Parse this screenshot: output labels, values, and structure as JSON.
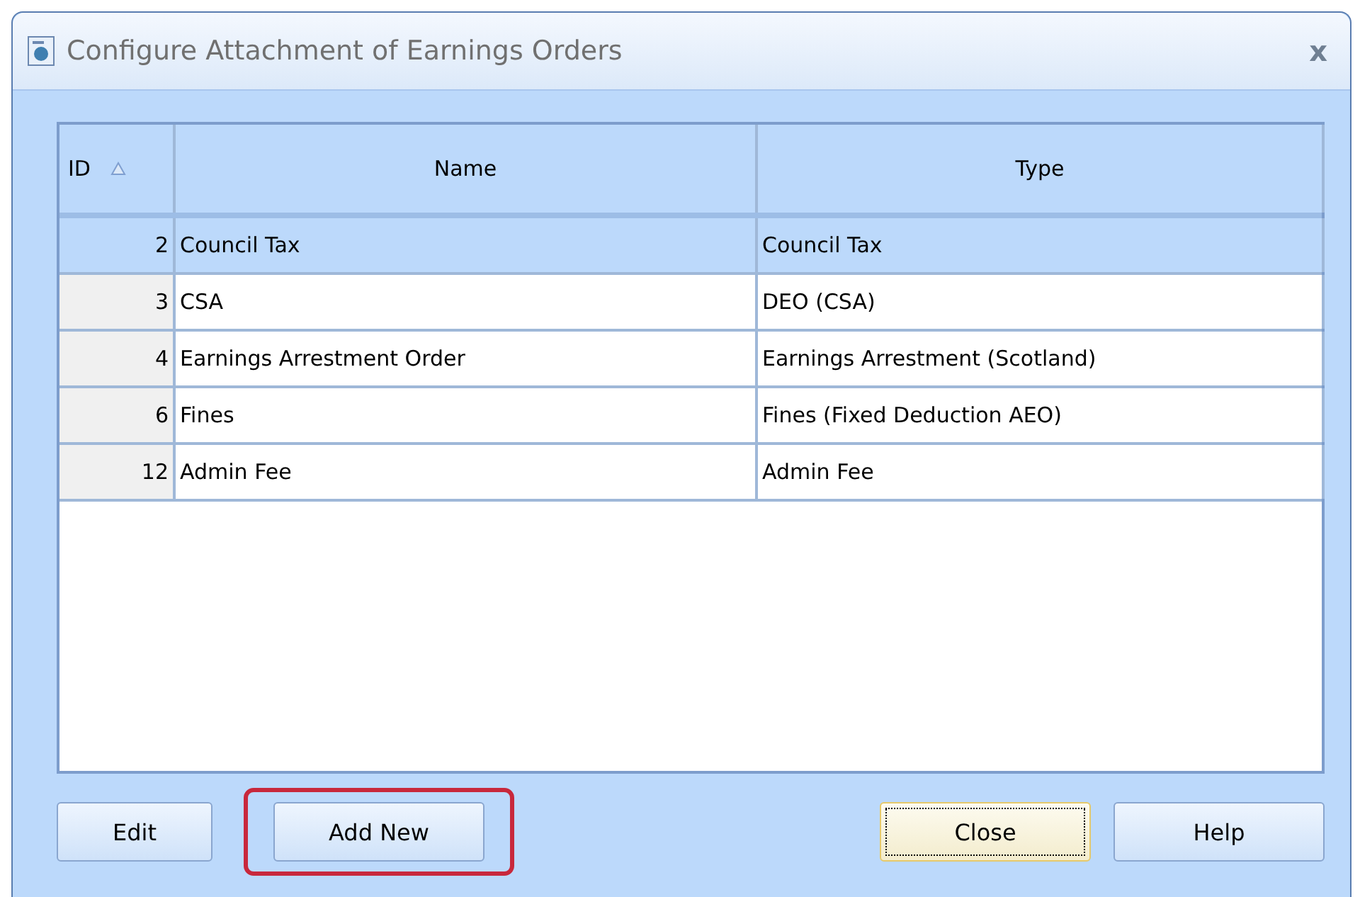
{
  "window": {
    "title": "Configure Attachment of Earnings Orders",
    "close": "x"
  },
  "table": {
    "columns": [
      {
        "label": "ID",
        "sorted": true
      },
      {
        "label": "Name",
        "sorted": false
      },
      {
        "label": "Type",
        "sorted": false
      }
    ],
    "rows": [
      {
        "id": "2",
        "name": "Council Tax",
        "type": "Council Tax",
        "selected": true
      },
      {
        "id": "3",
        "name": "CSA",
        "type": "DEO (CSA)",
        "selected": false
      },
      {
        "id": "4",
        "name": "Earnings Arrestment Order",
        "type": "Earnings Arrestment (Scotland)",
        "selected": false
      },
      {
        "id": "6",
        "name": "Fines",
        "type": "Fines (Fixed Deduction AEO)",
        "selected": false
      },
      {
        "id": "12",
        "name": "Admin Fee",
        "type": "Admin Fee",
        "selected": false
      }
    ]
  },
  "buttons": [
    {
      "label": "Edit",
      "highlighted": false,
      "focused": false
    },
    {
      "label": "Add New",
      "highlighted": true,
      "focused": false
    },
    {
      "label": "Close",
      "highlighted": false,
      "focused": true
    },
    {
      "label": "Help",
      "highlighted": false,
      "focused": false
    }
  ]
}
